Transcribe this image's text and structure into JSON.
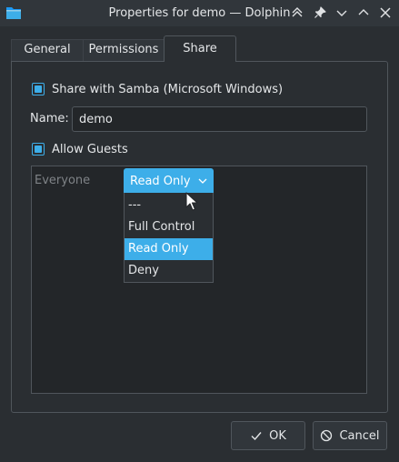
{
  "window": {
    "title": "Properties for demo — Dolphin",
    "icons": [
      "folder-icon",
      "keep-above-icon",
      "pin-icon",
      "minimize-icon",
      "maximize-icon",
      "close-icon"
    ]
  },
  "tabs": [
    {
      "label": "General",
      "active": false
    },
    {
      "label": "Permissions",
      "active": false
    },
    {
      "label": "Share",
      "active": true
    }
  ],
  "share": {
    "samba_label": "Share with Samba (Microsoft Windows)",
    "samba_checked": true,
    "name_label": "Name:",
    "name_value": "demo",
    "guests_label": "Allow Guests",
    "guests_checked": true,
    "permissions": {
      "user": "Everyone",
      "selected": "Read Only",
      "options": [
        "---",
        "Full Control",
        "Read Only",
        "Deny"
      ]
    }
  },
  "buttons": {
    "ok_label": "OK",
    "cancel_label": "Cancel"
  },
  "colors": {
    "accent": "#3daee9",
    "background": "#2a2e32",
    "titlebar": "#31363b"
  }
}
